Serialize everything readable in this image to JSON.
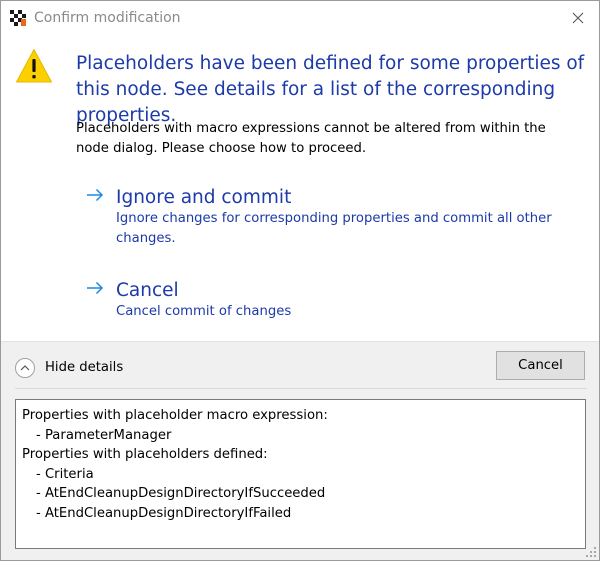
{
  "window": {
    "title": "Confirm modification",
    "app_icon": "checkered-flag-icon",
    "close_icon": "close-icon"
  },
  "main_instruction": "Placeholders have been defined for some properties of this node. See details for a list of the corresponding properties.",
  "content": "Placeholders with macro expressions cannot be altered from within the node dialog. Please choose how to proceed.",
  "commands": [
    {
      "title": "Ignore and commit",
      "note": "Ignore changes for corresponding properties and commit all other changes."
    },
    {
      "title": "Cancel",
      "note": "Cancel commit of changes"
    }
  ],
  "footer": {
    "expando_label": "Hide details",
    "cancel_label": "Cancel"
  },
  "details": {
    "heading1": "Properties with placeholder macro expression:",
    "group1": [
      "- ParameterManager"
    ],
    "heading2": "Properties with placeholders defined:",
    "group2": [
      "- Criteria",
      "- AtEndCleanupDesignDirectoryIfSucceeded",
      "- AtEndCleanupDesignDirectoryIfFailed"
    ]
  },
  "colors": {
    "instruction_blue": "#1c3aa9",
    "link_arrow_blue": "#1e88e5",
    "warning_yellow": "#fccf00",
    "footer_bg": "#f0f0f0"
  }
}
